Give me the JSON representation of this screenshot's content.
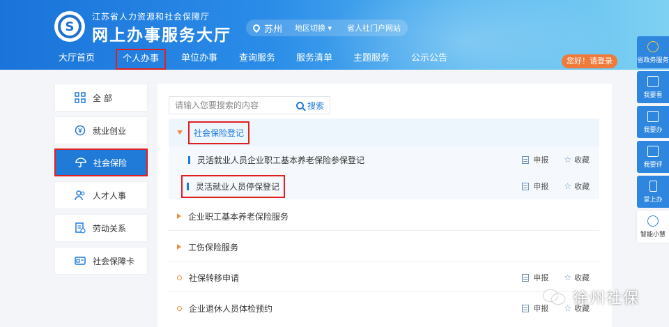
{
  "header": {
    "org_name": "江苏省人力资源和社会保障厅",
    "site_title": "网上办事服务大厅",
    "city": "苏州",
    "region_switch": "地区切换 ▾",
    "portal_link": "省人社门户网站",
    "nav": [
      "大厅首页",
      "个人办事",
      "单位办事",
      "查询服务",
      "服务清单",
      "主题服务",
      "公示公告"
    ],
    "login": "您好！请登录"
  },
  "left_menu": {
    "items": [
      {
        "label": "全 部",
        "icon": "grid-icon"
      },
      {
        "label": "就业创业",
        "icon": "yen-icon"
      },
      {
        "label": "社会保险",
        "icon": "umbrella-icon"
      },
      {
        "label": "人才人事",
        "icon": "people-icon"
      },
      {
        "label": "劳动关系",
        "icon": "document-icon"
      },
      {
        "label": "社会保障卡",
        "icon": "card-icon"
      }
    ],
    "active": "社会保险"
  },
  "search": {
    "placeholder": "请输入您要搜索的内容",
    "button": "搜索"
  },
  "services": {
    "group1_title": "社会保险登记",
    "group1_items": [
      {
        "label": "灵活就业人员企业职工基本养老保险参保登记",
        "apply": "申报",
        "fav": "收藏"
      },
      {
        "label": "灵活就业人员停保登记",
        "apply": "申报",
        "fav": "收藏"
      }
    ],
    "group2_title": "企业职工基本养老保险服务",
    "group3_title": "工伤保险服务",
    "group4": {
      "label": "社保转移申请",
      "apply": "申报",
      "fav": "收藏"
    },
    "group5": {
      "label": "企业退休人员体检预约",
      "apply": "申报",
      "fav": "收藏"
    }
  },
  "right_bar": {
    "items": [
      "省政务服务",
      "我要看",
      "我要办",
      "我要评",
      "掌上办",
      "智能小慧"
    ]
  },
  "watermark": "徐州社保",
  "colors": {
    "primary": "#1f7ad8",
    "accent": "#f08c3c",
    "highlight_box": "#e02020",
    "login": "#f07a3a"
  }
}
